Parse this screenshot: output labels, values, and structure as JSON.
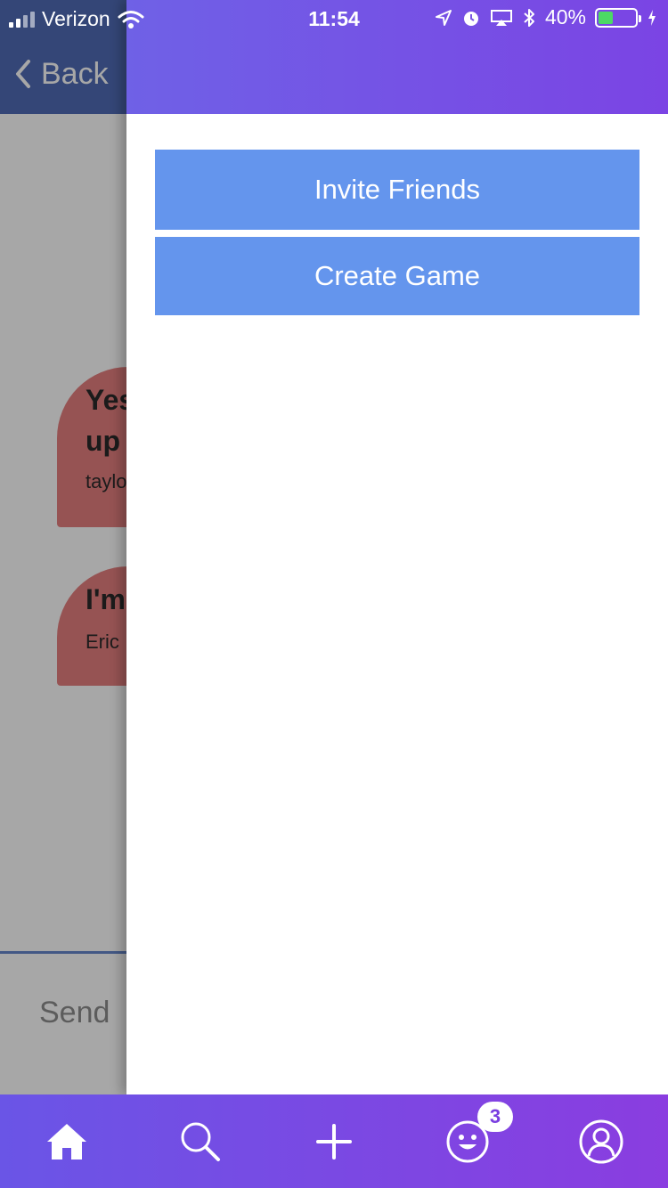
{
  "status_bar": {
    "carrier": "Verizon",
    "time": "11:54",
    "battery": "40%",
    "battery_level": 0.4
  },
  "nav": {
    "back_label": "Back"
  },
  "messages": [
    {
      "text": "Yes\nup",
      "author": "taylo"
    },
    {
      "text": "I'm",
      "author": "Eric"
    }
  ],
  "composer": {
    "placeholder": "Send"
  },
  "drawer": {
    "invite_label": "Invite Friends",
    "create_label": "Create Game"
  },
  "tab_bar": {
    "tabs": [
      {
        "icon": "home-icon"
      },
      {
        "icon": "search-icon"
      },
      {
        "icon": "plus-icon"
      },
      {
        "icon": "smiley-icon",
        "badge": "3"
      },
      {
        "icon": "profile-icon"
      }
    ]
  },
  "colors": {
    "nav_blue": "#2e4fa8",
    "drawer_button": "#6495ed",
    "bubble": "#e06666",
    "gradient_start": "#6f61e6",
    "gradient_end": "#8a3de0"
  }
}
